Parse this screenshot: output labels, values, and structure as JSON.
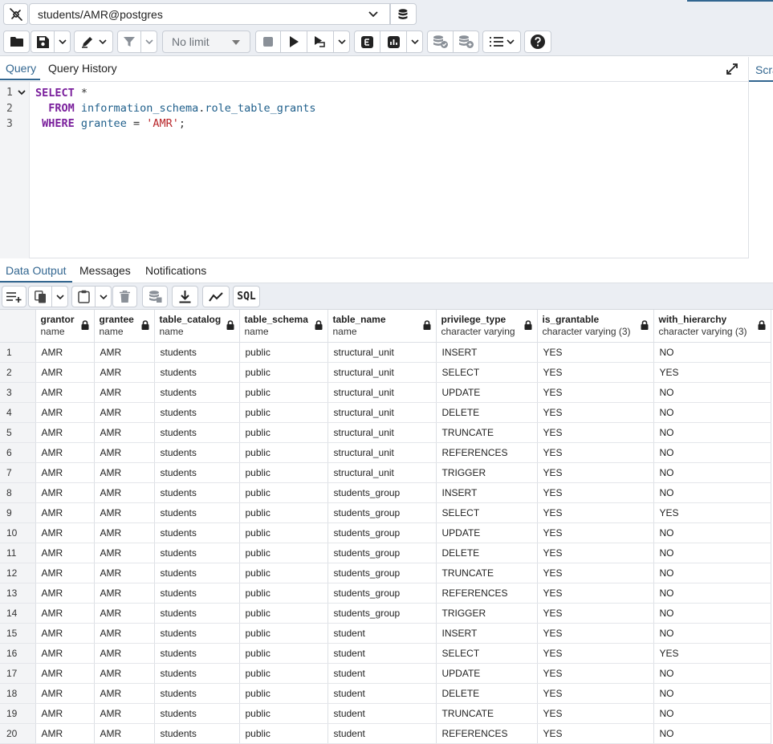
{
  "connection": {
    "label": "students/AMR@postgres"
  },
  "toolbar": {
    "limit_label": "No limit"
  },
  "query_tabs": [
    {
      "label": "Query",
      "active": true
    },
    {
      "label": "Query History",
      "active": false
    }
  ],
  "scratch_label": "Scratch Pad",
  "editor": {
    "line_numbers": [
      "1",
      "2",
      "3"
    ],
    "line1": {
      "kw1": "SELECT",
      "rest": " *"
    },
    "line2": {
      "indent": "  ",
      "kw": "FROM",
      "schema": "information_schema",
      "dot": ".",
      "table": "role_table_grants"
    },
    "line3": {
      "indent": " ",
      "kw": "WHERE",
      "col": "grantee",
      "eq": " = ",
      "str": "'AMR'",
      "semi": ";"
    }
  },
  "result_tabs": [
    {
      "label": "Data Output",
      "active": true
    },
    {
      "label": "Messages",
      "active": false
    },
    {
      "label": "Notifications",
      "active": false
    }
  ],
  "results": {
    "sql_label": "SQL",
    "columns": [
      {
        "name": "grantor",
        "type": "name"
      },
      {
        "name": "grantee",
        "type": "name"
      },
      {
        "name": "table_catalog",
        "type": "name"
      },
      {
        "name": "table_schema",
        "type": "name"
      },
      {
        "name": "table_name",
        "type": "name"
      },
      {
        "name": "privilege_type",
        "type": "character varying"
      },
      {
        "name": "is_grantable",
        "type": "character varying (3)"
      },
      {
        "name": "with_hierarchy",
        "type": "character varying (3)"
      }
    ],
    "rows": [
      [
        "1",
        "AMR",
        "AMR",
        "students",
        "public",
        "structural_unit",
        "INSERT",
        "YES",
        "NO"
      ],
      [
        "2",
        "AMR",
        "AMR",
        "students",
        "public",
        "structural_unit",
        "SELECT",
        "YES",
        "YES"
      ],
      [
        "3",
        "AMR",
        "AMR",
        "students",
        "public",
        "structural_unit",
        "UPDATE",
        "YES",
        "NO"
      ],
      [
        "4",
        "AMR",
        "AMR",
        "students",
        "public",
        "structural_unit",
        "DELETE",
        "YES",
        "NO"
      ],
      [
        "5",
        "AMR",
        "AMR",
        "students",
        "public",
        "structural_unit",
        "TRUNCATE",
        "YES",
        "NO"
      ],
      [
        "6",
        "AMR",
        "AMR",
        "students",
        "public",
        "structural_unit",
        "REFERENCES",
        "YES",
        "NO"
      ],
      [
        "7",
        "AMR",
        "AMR",
        "students",
        "public",
        "structural_unit",
        "TRIGGER",
        "YES",
        "NO"
      ],
      [
        "8",
        "AMR",
        "AMR",
        "students",
        "public",
        "students_group",
        "INSERT",
        "YES",
        "NO"
      ],
      [
        "9",
        "AMR",
        "AMR",
        "students",
        "public",
        "students_group",
        "SELECT",
        "YES",
        "YES"
      ],
      [
        "10",
        "AMR",
        "AMR",
        "students",
        "public",
        "students_group",
        "UPDATE",
        "YES",
        "NO"
      ],
      [
        "11",
        "AMR",
        "AMR",
        "students",
        "public",
        "students_group",
        "DELETE",
        "YES",
        "NO"
      ],
      [
        "12",
        "AMR",
        "AMR",
        "students",
        "public",
        "students_group",
        "TRUNCATE",
        "YES",
        "NO"
      ],
      [
        "13",
        "AMR",
        "AMR",
        "students",
        "public",
        "students_group",
        "REFERENCES",
        "YES",
        "NO"
      ],
      [
        "14",
        "AMR",
        "AMR",
        "students",
        "public",
        "students_group",
        "TRIGGER",
        "YES",
        "NO"
      ],
      [
        "15",
        "AMR",
        "AMR",
        "students",
        "public",
        "student",
        "INSERT",
        "YES",
        "NO"
      ],
      [
        "16",
        "AMR",
        "AMR",
        "students",
        "public",
        "student",
        "SELECT",
        "YES",
        "YES"
      ],
      [
        "17",
        "AMR",
        "AMR",
        "students",
        "public",
        "student",
        "UPDATE",
        "YES",
        "NO"
      ],
      [
        "18",
        "AMR",
        "AMR",
        "students",
        "public",
        "student",
        "DELETE",
        "YES",
        "NO"
      ],
      [
        "19",
        "AMR",
        "AMR",
        "students",
        "public",
        "student",
        "TRUNCATE",
        "YES",
        "NO"
      ],
      [
        "20",
        "AMR",
        "AMR",
        "students",
        "public",
        "student",
        "REFERENCES",
        "YES",
        "NO"
      ]
    ]
  },
  "icons": {
    "connection": "plug-connection-icon",
    "database": "database-icon",
    "open": "folder-open-icon",
    "save": "save-icon",
    "edit": "pen-edit-icon",
    "filter": "filter-icon",
    "stop": "stop-icon",
    "execute": "play-icon",
    "explain": "explain-icon",
    "analyze": "bar-chart-icon",
    "commit": "commit-icon",
    "rollback": "rollback-icon",
    "macros": "list-icon",
    "help": "help-icon",
    "lock": "lock-icon"
  },
  "colors": {
    "accent": "#326690",
    "keyword": "#7a1f9c",
    "identifier": "#1f5f8b",
    "string": "#b8262a"
  }
}
